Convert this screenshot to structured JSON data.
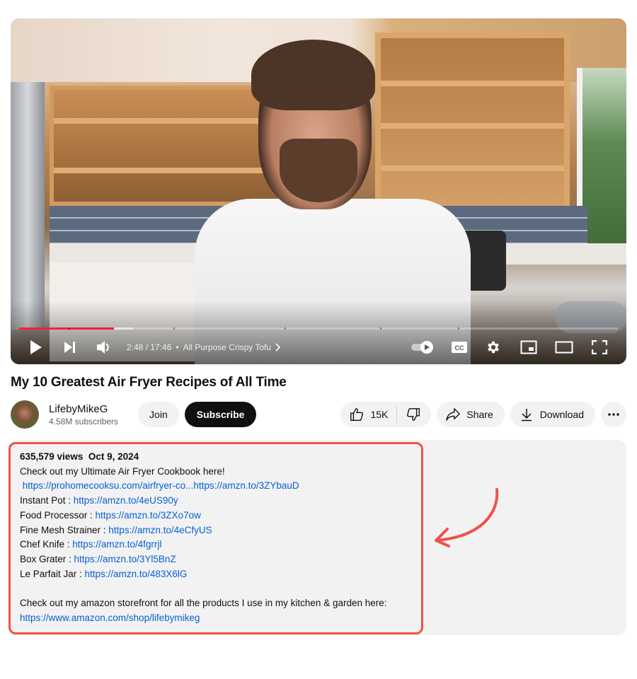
{
  "player": {
    "current_time": "2:48",
    "duration": "17:46",
    "time_display": "2:48 / 17:46",
    "chapter_separator": "•",
    "chapter_title": "All Purpose Crispy Tofu",
    "progress_played_fraction": 0.158,
    "progress_loaded_fraction": 0.19,
    "icons": {
      "play": "play-icon",
      "next": "next-icon",
      "volume": "volume-icon",
      "chapter_chevron": "chevron-right-icon",
      "autoplay": "autoplay-toggle-icon",
      "captions": "captions-icon",
      "settings": "gear-icon",
      "miniplayer": "miniplayer-icon",
      "theater": "theater-mode-icon",
      "fullscreen": "fullscreen-icon"
    },
    "colors": {
      "progress": "#ff1f3d"
    }
  },
  "video": {
    "title": "My 10 Greatest Air Fryer Recipes of All Time"
  },
  "channel": {
    "name": "LifebyMikeG",
    "subscribers": "4.58M subscribers",
    "join_label": "Join",
    "subscribe_label": "Subscribe"
  },
  "actions": {
    "like_count": "15K",
    "share_label": "Share",
    "download_label": "Download",
    "more_label": "More actions"
  },
  "description": {
    "views": "635,579 views",
    "date": "Oct 9, 2024",
    "intro": "Check out my Ultimate Air Fryer Cookbook here!",
    "cookbook_link": "https://prohomecooksu.com/airfryer-co...https://amzn.to/3ZYbauD",
    "products": [
      {
        "label": "Instant Pot : ",
        "link": "https://amzn.to/4eUS90y"
      },
      {
        "label": "Food Processor : ",
        "link": "https://amzn.to/3ZXo7ow"
      },
      {
        "label": "Fine Mesh Strainer : ",
        "link": "https://amzn.to/4eCfyUS"
      },
      {
        "label": "Chef Knife : ",
        "link": "https://amzn.to/4fgrrjl"
      },
      {
        "label": "Box Grater : ",
        "link": "https://amzn.to/3Yl5BnZ"
      },
      {
        "label": "Le Parfait Jar : ",
        "link": "https://amzn.to/483X6lG"
      }
    ],
    "storefront_text": "Check out my amazon storefront for all the products I use in my kitchen & garden here:",
    "storefront_link": "https://www.amazon.com/shop/lifebymikeg"
  },
  "annotation": {
    "highlight_color": "#f0524a",
    "arrow": "curved-arrow-icon"
  }
}
